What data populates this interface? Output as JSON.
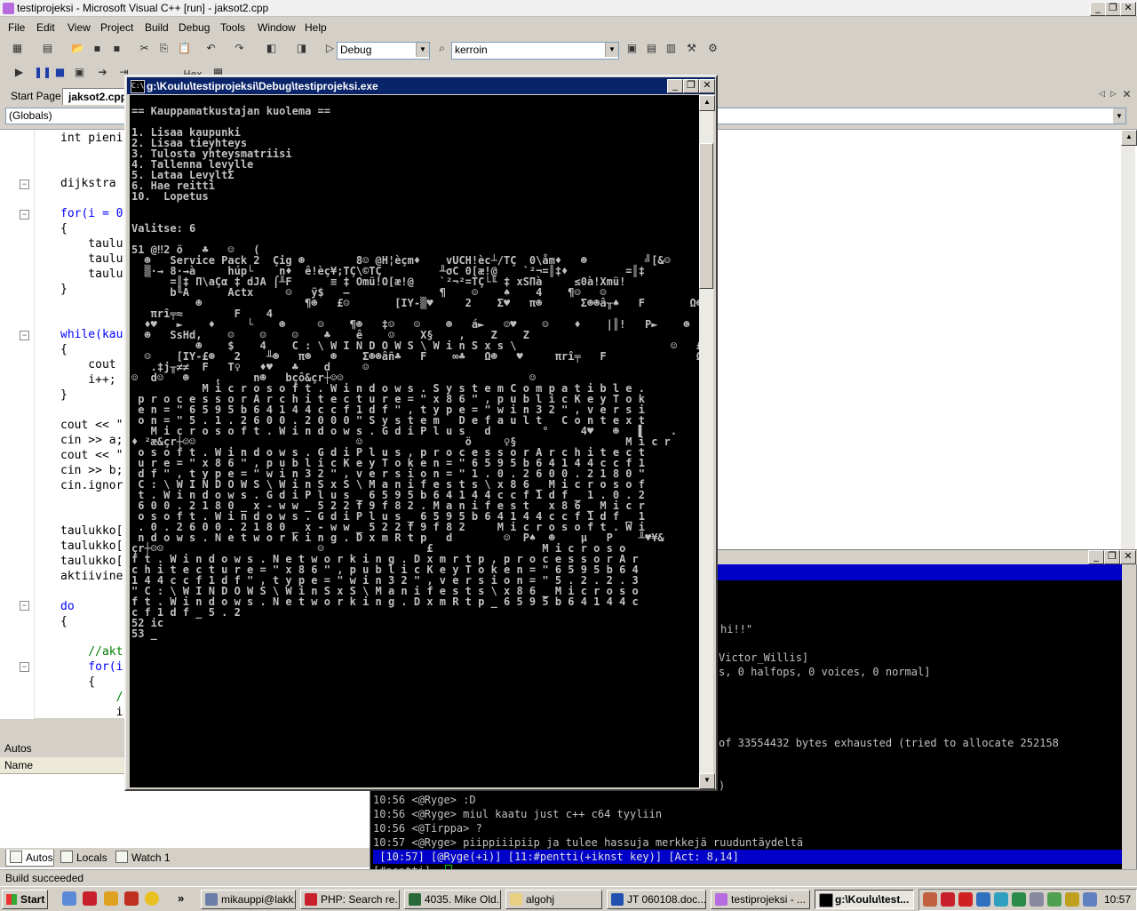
{
  "window": {
    "title": "testiprojeksi - Microsoft Visual C++ [run] - jaksot2.cpp",
    "controls": [
      "_",
      "❐",
      "✕"
    ]
  },
  "menu": [
    "File",
    "Edit",
    "View",
    "Project",
    "Build",
    "Debug",
    "Tools",
    "Window",
    "Help"
  ],
  "toolbar": {
    "config": "Debug",
    "find": "kerroin",
    "hex_label": "Hex"
  },
  "doctabs": [
    "Start Page",
    "jaksot2.cpp"
  ],
  "scope": "(Globals)",
  "code_lines": [
    "int pieni",
    "dijkstra",
    "for(i = 0",
    "{",
    "    taulu",
    "    taulu",
    "    taulu",
    "}",
    "while(kau",
    "{",
    "    cout",
    "    i++;",
    "}",
    "cout << \"",
    "cin >> a;",
    "cout << \"",
    "cin >> b;",
    "cin.ignor",
    "taulukko[",
    "taulukko[",
    "taulukko[",
    "aktiivine",
    "do",
    "{",
    "    //akt",
    "    for(i",
    "    {",
    "        /",
    "        i"
  ],
  "autos": {
    "title": "Autos",
    "column": "Name",
    "tabs": [
      "Autos",
      "Locals",
      "Watch 1"
    ]
  },
  "status": "Build succeeded",
  "console": {
    "title": "g:\\Koulu\\testiprojeksi\\Debug\\testiprojeksi.exe",
    "lines": [
      "== Kauppamatkustajan kuolema ==",
      "",
      "1. Lisaa kaupunki",
      "2. Lisaa tieyhteys",
      "3. Tulosta yhteysmatriisi",
      "4. Tallenna levylle",
      "5. Lataa LevyltΣ",
      "6. Hae reitti",
      "10.  Lopetus",
      "",
      "",
      "Valitse: 6",
      "",
      "51 @‼2 ö   ♣   ☺   (",
      "  ☻   Service Pack 2  Çig ☻        8☺ @H¦èçm♦    vUCH!èc┴/TÇ  0\\åm♦   ☻         ╝[&☺",
      "  ▒·→ 8·→à     húp└    n♦  ê!èç¥;TÇ\\©TÇ         ╨σC 0[æ!@    `²¬=║‡♦         =║‡",
      "      =║‡ Π\\aÇα ‡ dJA ⌠╨F      ≡ ‡ Omü!O[æ!@    `²¬²=TÇ└╙ ‡ xSΠà     ≤0à!Xmü!",
      "      b╙A      Actx     ☺   ÿ$   —              ¶    ☺    ♠    4    ¶☺   ☺",
      "          ☻                ¶☻   £☺       [IY-▒♥     2    Σ♥   π☻      Σ☻☻â╥♠   F       Ω☻",
      "   πrî╤≈        F    4",
      "  ♦♥   ►    ♦     └    ☻     ☺    ¶☻   ‡☺   ☺    ☻   á►   ☺♥    ☺    ♦    |║!   P►    ☻    ♠    └$   !",
      "  ☻   SsHd,    ☺    ☺    ☺    ♣    ê    ☺    X§    ,    Z    Z",
      "          ☻    $    4    C : \\ W I N D O W S \\ W i n S x s \\                        ☺   £☺",
      "  ☺    [IY-£☻   2    ╨☻   π☻   ☻    Σ☻☻âñ♣   F    ∞♣   Ω☻   ♥     πrî╤   F              Ω☻   ♦",
      "   .‡j╥≠≠  F   T♀   ♦♥   ♣    d     ☺",
      "☺  d☺   ☻    ,     n☻   bçô&çr┼☺☺                             ☺",
      "           M i c r o s o f t . W i n d o w s . S y s t e m C o m p a t i b l e .",
      " p r o c e s s o r A r c h i t e c t u r e = \" x 8 6 \" , p u b l i c K e y T o k",
      " e n = \" 6 5 9 5 b 6 4 1 4 4 c c f 1 d f \" , t y p e = \" w i n 3 2 \" , v e r s i",
      " o n = \" 5 . 1 . 2 6 0 0 . 2 0 0 0 \" S y s t e m   D e f a u l t   C o n t e x t",
      "   M i c r o s o f t . W i n d o w s . G d i P l u s   d        °     4♥   ☻   ▌    .",
      "♦ ²æ&çr┼☺☺                         ☺                ö     ♀§                 M i c r",
      " o s o f t . W i n d o w s . G d i P l u s , p r o c e s s o r A r c h i t e c t",
      " u r e = \" x 8 6 \" , p u b l i c K e y T o k e n = \" 6 5 9 5 b 6 4 1 4 4 c c f 1",
      " d f \" , t y p e = \" w i n 3 2 \" , v e r s i o n = \" 1 . 0 . 2 6 0 0 . 2 1 8 0 \"",
      " C : \\ W I N D O W S \\ W i n S x S \\ M a n i f e s t s \\ x 8 6 _ M i c r o s o f",
      " t . W i n d o w s . G d i P l u s _ 6 5 9 5 b 6 4 1 4 4 c c f 1 d f _ 1 . 0 . 2",
      " 6 0 0 . 2 1 8 0 _ x - w w _ 5 2 2 f 9 f 8 2 . M a n i f e s t   x 8 6 _ M i c r",
      " o s o f t . W i n d o w s . G d i P l u s _ 6 5 9 5 b 6 4 1 4 4 c c f 1 d f _ 1",
      " . 0 . 2 6 0 0 . 2 1 8 0 _ x - w w _ 5 2 2 f 9 f 8 2     M i c r o s o f t . W i",
      " n d o w s . N e t w o r k i n g . D x m R t p   d        ☺  P♠  ☻    µ   P    ╨♥¥&",
      "çr┼☺☺                        ☺                £                 M i c r o s o",
      "f t . W i n d o w s . N e t w o r k i n g . D x m r t p , p r o c e s s o r A r",
      "c h i t e c t u r e = \" x 8 6 \" , p u b l i c K e y T o k e n = \" 6 5 9 5 b 6 4",
      "1 4 4 c c f 1 d f \" , t y p e = \" w i n 3 2 \" , v e r s i o n = \" 5 . 2 . 2 . 3",
      "\" C : \\ W I N D O W S \\ W i n S x S \\ M a n i f e s t s \\ x 8 6 _ M i c r o s o",
      "f t . W i n d o w s . N e t w o r k i n g . D x m R t p _ 6 5 9 5 b 6 4 1 4 4 c",
      "c f 1 d f _ 5 . 2",
      "52 ic",
      "53 _"
    ]
  },
  "irc": {
    "partial_lines": [
      "hi!!\"",
      "Victor_Willis]",
      "s, 0 halfops, 0 voices, 0 normal]",
      "of 33554432 bytes exhausted (tried to allocate 252158",
      ")"
    ],
    "lines": [
      "10:56 <@Ryge> :D",
      "10:56 <@Ryge> miul kaatu just c++ c64 tyyliin",
      "10:56 <@Tirppa> ?",
      "10:57 <@Ryge> piippiiipiip ja tulee hassuja merkkejä ruuduntäydeltä"
    ],
    "statusline": " [10:57] [@Ryge(+i)] [11:#pentti(+iknst key)] [Act: 8,14]",
    "prompt": "[#pentti] "
  },
  "taskbar": {
    "start": "Start",
    "items": [
      "mikauppi@lakk...",
      "PHP: Search re...",
      "4035. Mike Old...",
      "algohj",
      "JT 060108.doc...",
      "testiprojeksi - ...",
      "g:\\Koulu\\test..."
    ],
    "clock": "10:57",
    "overflow": "»"
  }
}
